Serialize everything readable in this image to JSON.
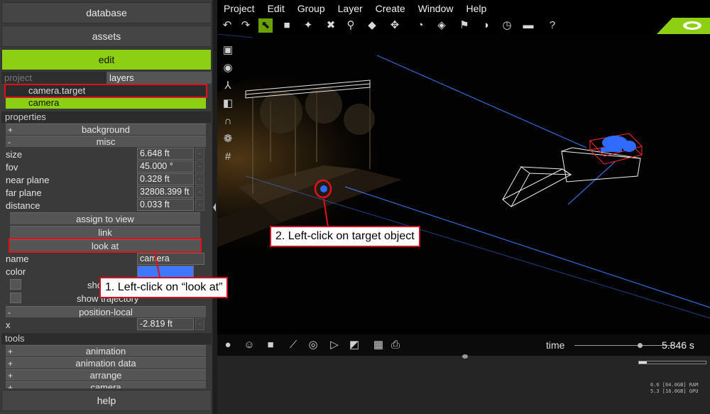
{
  "left_panel": {
    "nav": {
      "database": "database",
      "assets": "assets",
      "edit": "edit",
      "help": "help"
    },
    "tabs": {
      "project": "project",
      "layers": "layers"
    },
    "layers": [
      "camera.target",
      "camera"
    ],
    "sections": {
      "properties": "properties",
      "tools": "tools"
    },
    "groups": {
      "background": {
        "sign": "+",
        "label": "background"
      },
      "misc": {
        "sign": "-",
        "label": "misc"
      },
      "position_local": {
        "sign": "-",
        "label": "position-local"
      }
    },
    "props": {
      "size": {
        "label": "size",
        "value": "6.648 ft"
      },
      "fov": {
        "label": "fov",
        "value": "45.000 °"
      },
      "near_plane": {
        "label": "near plane",
        "value": "0.328 ft"
      },
      "far_plane": {
        "label": "far plane",
        "value": "32808.399 ft"
      },
      "distance": {
        "label": "distance",
        "value": "0.033 ft"
      },
      "name": {
        "label": "name",
        "value": "camera"
      },
      "color": {
        "label": "color",
        "value": "#3d78ff"
      },
      "x": {
        "label": "x",
        "value": "-2.819 ft"
      }
    },
    "spin_glyph": "-",
    "actions": {
      "assign_to_view": "assign to view",
      "link": "link",
      "look_at": "look at"
    },
    "checkboxes": {
      "show": "sho",
      "show_trajectory": "show trajectory"
    },
    "tools": [
      {
        "sign": "+",
        "label": "animation"
      },
      {
        "sign": "+",
        "label": "animation data"
      },
      {
        "sign": "+",
        "label": "arrange"
      },
      {
        "sign": "+",
        "label": "camera"
      }
    ]
  },
  "menubar": [
    "Project",
    "Edit",
    "Group",
    "Layer",
    "Create",
    "Window",
    "Help"
  ],
  "toolbar_icons": [
    "undo-icon",
    "redo-icon",
    "select-icon",
    "box-icon",
    "snap-icon",
    "delete-icon",
    "zoom-icon",
    "cube-icon",
    "move-icon",
    "rotate-icon",
    "tag-icon",
    "flag-icon",
    "gauge-icon",
    "clock-icon",
    "ruler-icon",
    "help-icon"
  ],
  "bottom_bar": {
    "time_label": "time",
    "time_value": "5.846 s",
    "time_fraction": 0.66
  },
  "status": {
    "ram": "6.6 [64.0GB] RAM",
    "gpu": "5.3 [16.0GB] GPU",
    "mem_fraction": 0.12
  },
  "callouts": {
    "step1": "1. Left-click on “look at”",
    "step2": "2. Left-click on target object"
  },
  "colors": {
    "accent": "#8dcf12",
    "highlight": "#e0111a",
    "camera_blue": "#3d78ff"
  }
}
